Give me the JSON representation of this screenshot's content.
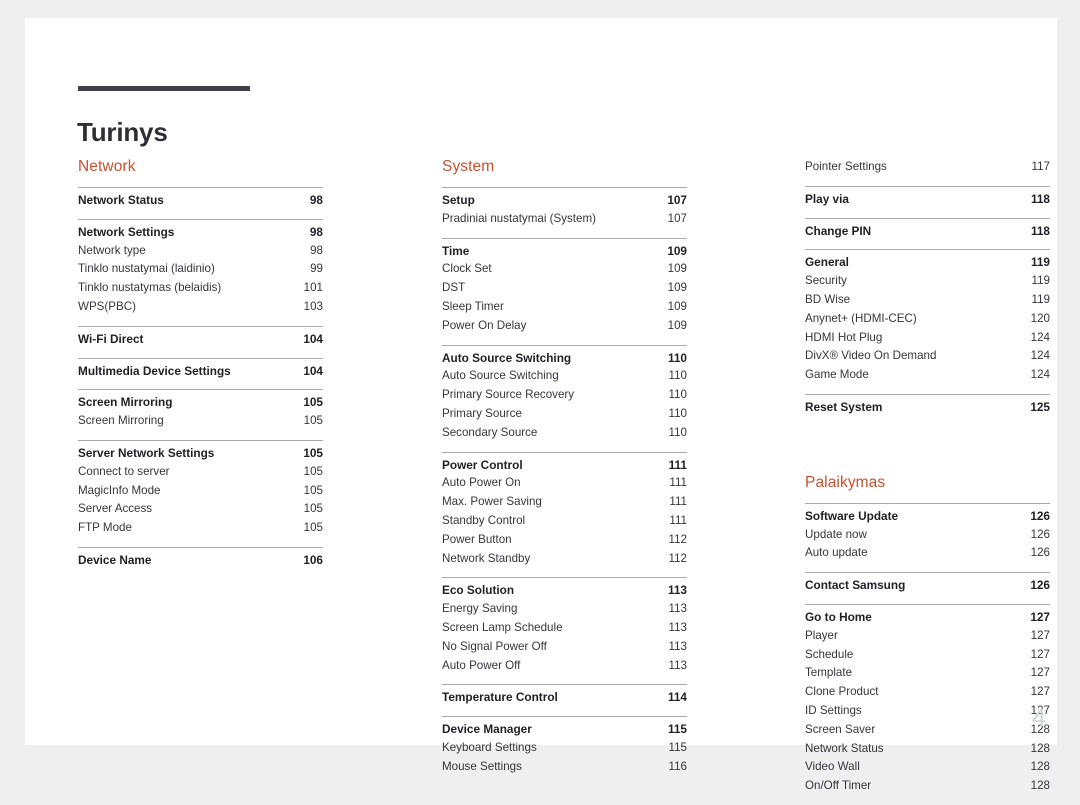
{
  "document": {
    "title": "Turinys",
    "folio": "4",
    "accent_color": "#c8512f",
    "rule_color": "#403e48"
  },
  "columns": [
    {
      "name": "column-left",
      "sections": [
        {
          "title": "Network",
          "groups": [
            {
              "rule": true,
              "rows": [
                {
                  "label": "Network Status",
                  "page": "98",
                  "head": true
                }
              ]
            },
            {
              "rule": true,
              "rows": [
                {
                  "label": "Network Settings",
                  "page": "98",
                  "head": true
                },
                {
                  "label": "Network type",
                  "page": "98",
                  "head": false
                },
                {
                  "label": "Tinklo nustatymai (laidinio)",
                  "page": "99",
                  "head": false
                },
                {
                  "label": "Tinklo nustatymas (belaidis)",
                  "page": "101",
                  "head": false
                },
                {
                  "label": "WPS(PBC)",
                  "page": "103",
                  "head": false
                }
              ]
            },
            {
              "rule": true,
              "rows": [
                {
                  "label": "Wi-Fi Direct",
                  "page": "104",
                  "head": true
                }
              ]
            },
            {
              "rule": true,
              "rows": [
                {
                  "label": "Multimedia Device Settings",
                  "page": "104",
                  "head": true
                }
              ]
            },
            {
              "rule": true,
              "rows": [
                {
                  "label": "Screen Mirroring",
                  "page": "105",
                  "head": true
                },
                {
                  "label": "Screen Mirroring",
                  "page": "105",
                  "head": false
                }
              ]
            },
            {
              "rule": true,
              "rows": [
                {
                  "label": "Server Network Settings",
                  "page": "105",
                  "head": true
                },
                {
                  "label": "Connect to server",
                  "page": "105",
                  "head": false
                },
                {
                  "label": "MagicInfo Mode",
                  "page": "105",
                  "head": false
                },
                {
                  "label": "Server Access",
                  "page": "105",
                  "head": false
                },
                {
                  "label": "FTP Mode",
                  "page": "105",
                  "head": false
                }
              ]
            },
            {
              "rule": true,
              "rows": [
                {
                  "label": "Device Name",
                  "page": "106",
                  "head": true
                }
              ]
            }
          ]
        }
      ]
    },
    {
      "name": "column-middle",
      "sections": [
        {
          "title": "System",
          "groups": [
            {
              "rule": true,
              "rows": [
                {
                  "label": "Setup",
                  "page": "107",
                  "head": true
                },
                {
                  "label": "Pradiniai nustatymai (System)",
                  "page": "107",
                  "head": false
                }
              ]
            },
            {
              "rule": true,
              "rows": [
                {
                  "label": "Time",
                  "page": "109",
                  "head": true
                },
                {
                  "label": "Clock Set",
                  "page": "109",
                  "head": false
                },
                {
                  "label": "DST",
                  "page": "109",
                  "head": false
                },
                {
                  "label": "Sleep Timer",
                  "page": "109",
                  "head": false
                },
                {
                  "label": "Power On Delay",
                  "page": "109",
                  "head": false
                }
              ]
            },
            {
              "rule": true,
              "rows": [
                {
                  "label": "Auto Source Switching",
                  "page": "110",
                  "head": true
                },
                {
                  "label": "Auto Source Switching",
                  "page": "110",
                  "head": false
                },
                {
                  "label": "Primary Source Recovery",
                  "page": "110",
                  "head": false
                },
                {
                  "label": "Primary Source",
                  "page": "110",
                  "head": false
                },
                {
                  "label": "Secondary Source",
                  "page": "110",
                  "head": false
                }
              ]
            },
            {
              "rule": true,
              "rows": [
                {
                  "label": "Power Control",
                  "page": "111",
                  "head": true
                },
                {
                  "label": "Auto Power On",
                  "page": "111",
                  "head": false
                },
                {
                  "label": "Max. Power Saving",
                  "page": "111",
                  "head": false
                },
                {
                  "label": "Standby Control",
                  "page": "111",
                  "head": false
                },
                {
                  "label": "Power Button",
                  "page": "112",
                  "head": false
                },
                {
                  "label": "Network Standby",
                  "page": "112",
                  "head": false
                }
              ]
            },
            {
              "rule": true,
              "rows": [
                {
                  "label": "Eco Solution",
                  "page": "113",
                  "head": true
                },
                {
                  "label": "Energy Saving",
                  "page": "113",
                  "head": false
                },
                {
                  "label": "Screen Lamp Schedule",
                  "page": "113",
                  "head": false
                },
                {
                  "label": "No Signal Power Off",
                  "page": "113",
                  "head": false
                },
                {
                  "label": "Auto Power Off",
                  "page": "113",
                  "head": false
                }
              ]
            },
            {
              "rule": true,
              "rows": [
                {
                  "label": "Temperature Control",
                  "page": "114",
                  "head": true
                }
              ]
            },
            {
              "rule": true,
              "rows": [
                {
                  "label": "Device Manager",
                  "page": "115",
                  "head": true
                },
                {
                  "label": "Keyboard Settings",
                  "page": "115",
                  "head": false
                },
                {
                  "label": "Mouse Settings",
                  "page": "116",
                  "head": false
                }
              ]
            }
          ]
        }
      ]
    },
    {
      "name": "column-right",
      "sections": [
        {
          "title": "",
          "groups": [
            {
              "rule": false,
              "rows": [
                {
                  "label": "Pointer Settings",
                  "page": "117",
                  "head": false
                }
              ]
            },
            {
              "rule": true,
              "rows": [
                {
                  "label": "Play via",
                  "page": "118",
                  "head": true
                }
              ]
            },
            {
              "rule": true,
              "rows": [
                {
                  "label": "Change PIN",
                  "page": "118",
                  "head": true
                }
              ]
            },
            {
              "rule": true,
              "rows": [
                {
                  "label": "General",
                  "page": "119",
                  "head": true
                },
                {
                  "label": "Security",
                  "page": "119",
                  "head": false
                },
                {
                  "label": "BD Wise",
                  "page": "119",
                  "head": false
                },
                {
                  "label": "Anynet+ (HDMI-CEC)",
                  "page": "120",
                  "head": false
                },
                {
                  "label": "HDMI Hot Plug",
                  "page": "124",
                  "head": false
                },
                {
                  "label": "DivX® Video On Demand",
                  "page": "124",
                  "head": false
                },
                {
                  "label": "Game Mode",
                  "page": "124",
                  "head": false
                }
              ]
            },
            {
              "rule": true,
              "rows": [
                {
                  "label": "Reset System",
                  "page": "125",
                  "head": true
                }
              ]
            }
          ]
        },
        {
          "title": "Palaikymas",
          "groups": [
            {
              "rule": true,
              "rows": [
                {
                  "label": "Software Update",
                  "page": "126",
                  "head": true
                },
                {
                  "label": "Update now",
                  "page": "126",
                  "head": false
                },
                {
                  "label": "Auto update",
                  "page": "126",
                  "head": false
                }
              ]
            },
            {
              "rule": true,
              "rows": [
                {
                  "label": "Contact Samsung",
                  "page": "126",
                  "head": true
                }
              ]
            },
            {
              "rule": true,
              "rows": [
                {
                  "label": "Go to Home",
                  "page": "127",
                  "head": true
                },
                {
                  "label": "Player",
                  "page": "127",
                  "head": false
                },
                {
                  "label": "Schedule",
                  "page": "127",
                  "head": false
                },
                {
                  "label": "Template",
                  "page": "127",
                  "head": false
                },
                {
                  "label": "Clone Product",
                  "page": "127",
                  "head": false
                },
                {
                  "label": "ID Settings",
                  "page": "127",
                  "head": false
                },
                {
                  "label": "Screen Saver",
                  "page": "128",
                  "head": false
                },
                {
                  "label": "Network Status",
                  "page": "128",
                  "head": false
                },
                {
                  "label": "Video Wall",
                  "page": "128",
                  "head": false
                },
                {
                  "label": "On/Off Timer",
                  "page": "128",
                  "head": false
                }
              ]
            }
          ]
        }
      ]
    }
  ]
}
